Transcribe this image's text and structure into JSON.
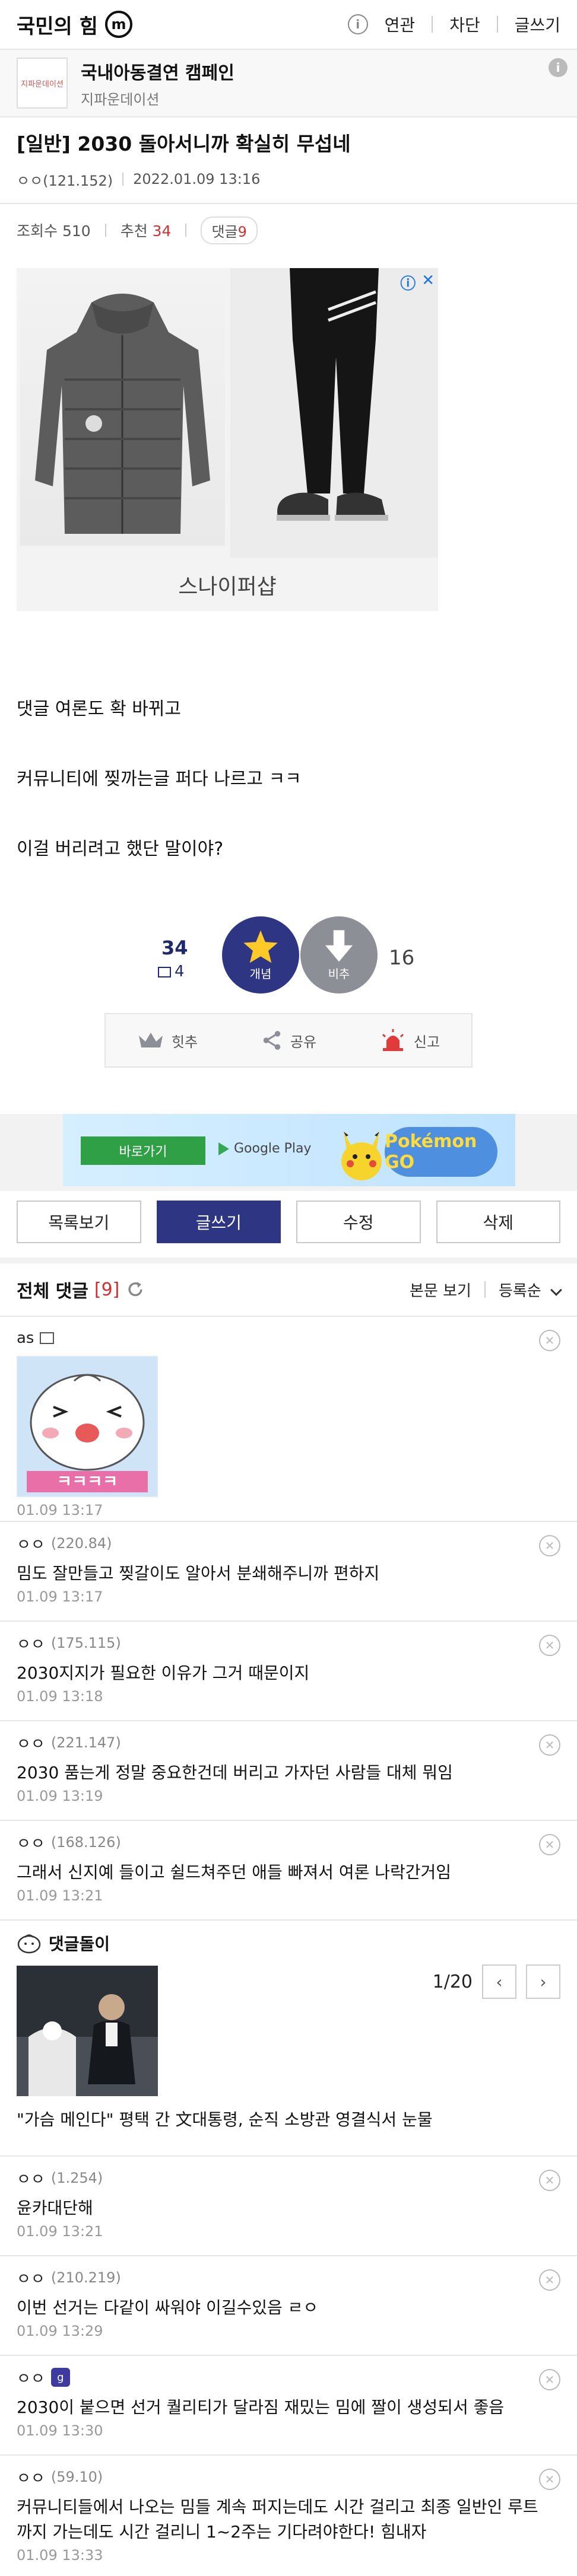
{
  "header": {
    "site_title": "국민의 힘",
    "logo_glyph": "m",
    "info_glyph": "i",
    "actions": [
      "연관",
      "차단",
      "글쓰기"
    ]
  },
  "ad_strip": {
    "logo_text": "지파운데이션",
    "title": "국내아동결연 캠페인",
    "subtitle": "지파운데이션",
    "info_glyph": "i"
  },
  "post": {
    "title": "[일반] 2030 돌아서니까 확실히 무섭네",
    "author": "ㅇㅇ(121.152)",
    "date": "2022.01.09 13:16",
    "views_label": "조회수",
    "views": "510",
    "rec_label": "추천",
    "rec": "34",
    "reply_label": "댓글",
    "reply_count": "9",
    "body": [
      "댓글 여론도 확 바뀌고",
      "커뮤니티에 찢까는글 퍼다 나르고 ㅋㅋ",
      "이걸 버리려고 했단 말이야?"
    ]
  },
  "product_ad": {
    "name": "스나이퍼샵",
    "choices_i": "ⓘ",
    "choices_x": "✕"
  },
  "vote": {
    "rec_count": "34",
    "rec_sub": "4",
    "rec_label": "개념",
    "nrec_label": "비추",
    "nrec_count": "16"
  },
  "actions": {
    "hitchu": "힛추",
    "share": "공유",
    "report": "신고"
  },
  "banner": {
    "button": "바로가기",
    "store": "Google Play",
    "game": "Pokémon GO"
  },
  "buttons": {
    "list": "목록보기",
    "write": "글쓰기",
    "edit": "수정",
    "delete": "삭제"
  },
  "comments_header": {
    "title": "전체 댓글",
    "count": "[9]",
    "view_body": "본문 보기",
    "sort": "등록순"
  },
  "comments": [
    {
      "author": "as",
      "ip": "",
      "text": "",
      "time": "01.09 13:17",
      "sticker": "ㅋㅋㅋㅋ"
    },
    {
      "author": "ㅇㅇ",
      "ip": "(220.84)",
      "text": "밈도 잘만들고 찢갈이도 알아서 분쇄해주니까 편하지",
      "time": "01.09 13:17"
    },
    {
      "author": "ㅇㅇ",
      "ip": "(175.115)",
      "text": "2030지지가 필요한 이유가 그거 때문이지",
      "time": "01.09 13:18"
    },
    {
      "author": "ㅇㅇ",
      "ip": "(221.147)",
      "text": "2030 품는게 정말 중요한건데 버리고 가자던 사람들 대체 뭐임",
      "time": "01.09 13:19"
    },
    {
      "author": "ㅇㅇ",
      "ip": "(168.126)",
      "text": "그래서 신지예 들이고 쉴드쳐주던 애들 빠져서 여론 나락간거임",
      "time": "01.09 13:21"
    }
  ],
  "hot": {
    "title": "댓글돌이",
    "page": "1/20",
    "caption": "\"가슴 메인다\" 평택 간 文대통령, 순직 소방관 영결식서 눈물"
  },
  "comments2": [
    {
      "author": "ㅇㅇ",
      "ip": "(1.254)",
      "text": "윤카대단해",
      "time": "01.09 13:21"
    },
    {
      "author": "ㅇㅇ",
      "ip": "(210.219)",
      "text": "이번 선거는 다같이 싸워야 이길수있음 ㄹㅇ",
      "time": "01.09 13:29"
    },
    {
      "author": "ㅇㅇ",
      "ip": "",
      "text": "2030이 붙으면 선거 퀄리티가 달라짐 재밌는 밈에 짤이 생성되서 좋음",
      "time": "01.09 13:30",
      "tag": "g"
    },
    {
      "author": "ㅇㅇ",
      "ip": "(59.10)",
      "text": "커뮤니티들에서 나오는 밈들 계속 퍼지는데도 시간 걸리고 최종 일반인 루트까지 가는데도 시간 걸리니 1~2주는 기다려야한다! 힘내자",
      "time": "01.09 13:33"
    }
  ]
}
